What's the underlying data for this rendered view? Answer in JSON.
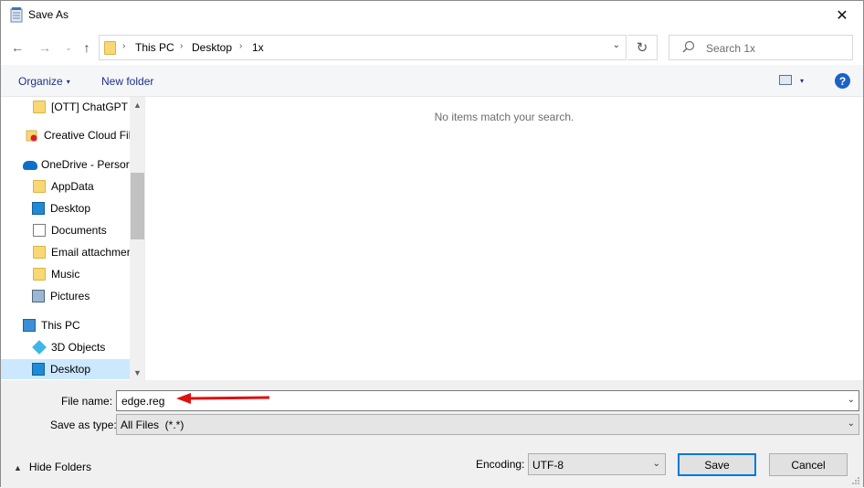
{
  "window": {
    "title": "Save As",
    "close_glyph": "✕"
  },
  "nav": {
    "back_glyph": "←",
    "forward_glyph": "→",
    "history_glyph": "⌄",
    "up_glyph": "↑",
    "breadcrumb": [
      "This PC",
      "Desktop",
      "1x"
    ],
    "separator": "›",
    "dropdown_glyph": "⌄",
    "refresh_glyph": "↻",
    "search_placeholder": "Search 1x"
  },
  "toolbar": {
    "organize_label": "Organize",
    "organize_caret": "▾",
    "new_folder_label": "New folder",
    "view_caret": "▾",
    "help_glyph": "?"
  },
  "navpane": {
    "items": [
      {
        "label": "[OTT] ChatGPT A",
        "icon": "folder-icon"
      },
      {
        "label": "Creative Cloud Fil",
        "icon": "creative-cloud-icon"
      },
      {
        "label": "OneDrive - Persor",
        "icon": "onedrive-icon"
      },
      {
        "label": "AppData",
        "icon": "folder-icon"
      },
      {
        "label": "Desktop",
        "icon": "desktop-icon"
      },
      {
        "label": "Documents",
        "icon": "documents-icon"
      },
      {
        "label": "Email attachmer",
        "icon": "folder-icon"
      },
      {
        "label": "Music",
        "icon": "folder-icon"
      },
      {
        "label": "Pictures",
        "icon": "pictures-icon"
      },
      {
        "label": "This PC",
        "icon": "this-pc-icon"
      },
      {
        "label": "3D Objects",
        "icon": "3d-objects-icon"
      },
      {
        "label": "Desktop",
        "icon": "desktop-icon",
        "selected": true
      }
    ],
    "scroll_up_glyph": "▲",
    "scroll_down_glyph": "▼"
  },
  "content": {
    "empty_message": "No items match your search."
  },
  "form": {
    "file_name_label": "File name:",
    "file_name_value": "edge.reg",
    "save_type_label": "Save as type:",
    "save_type_value": "All Files  (*.*)",
    "dropdown_glyph": "⌄",
    "encoding_label": "Encoding:",
    "encoding_value": "UTF-8",
    "hide_folders_label": "Hide Folders",
    "hide_folders_glyph": "▲",
    "save_label": "Save",
    "cancel_label": "Cancel"
  },
  "colors": {
    "accent": "#0078d7",
    "link": "#1e3287",
    "selection": "#cce8ff",
    "annotation_arrow": "#e01010"
  }
}
